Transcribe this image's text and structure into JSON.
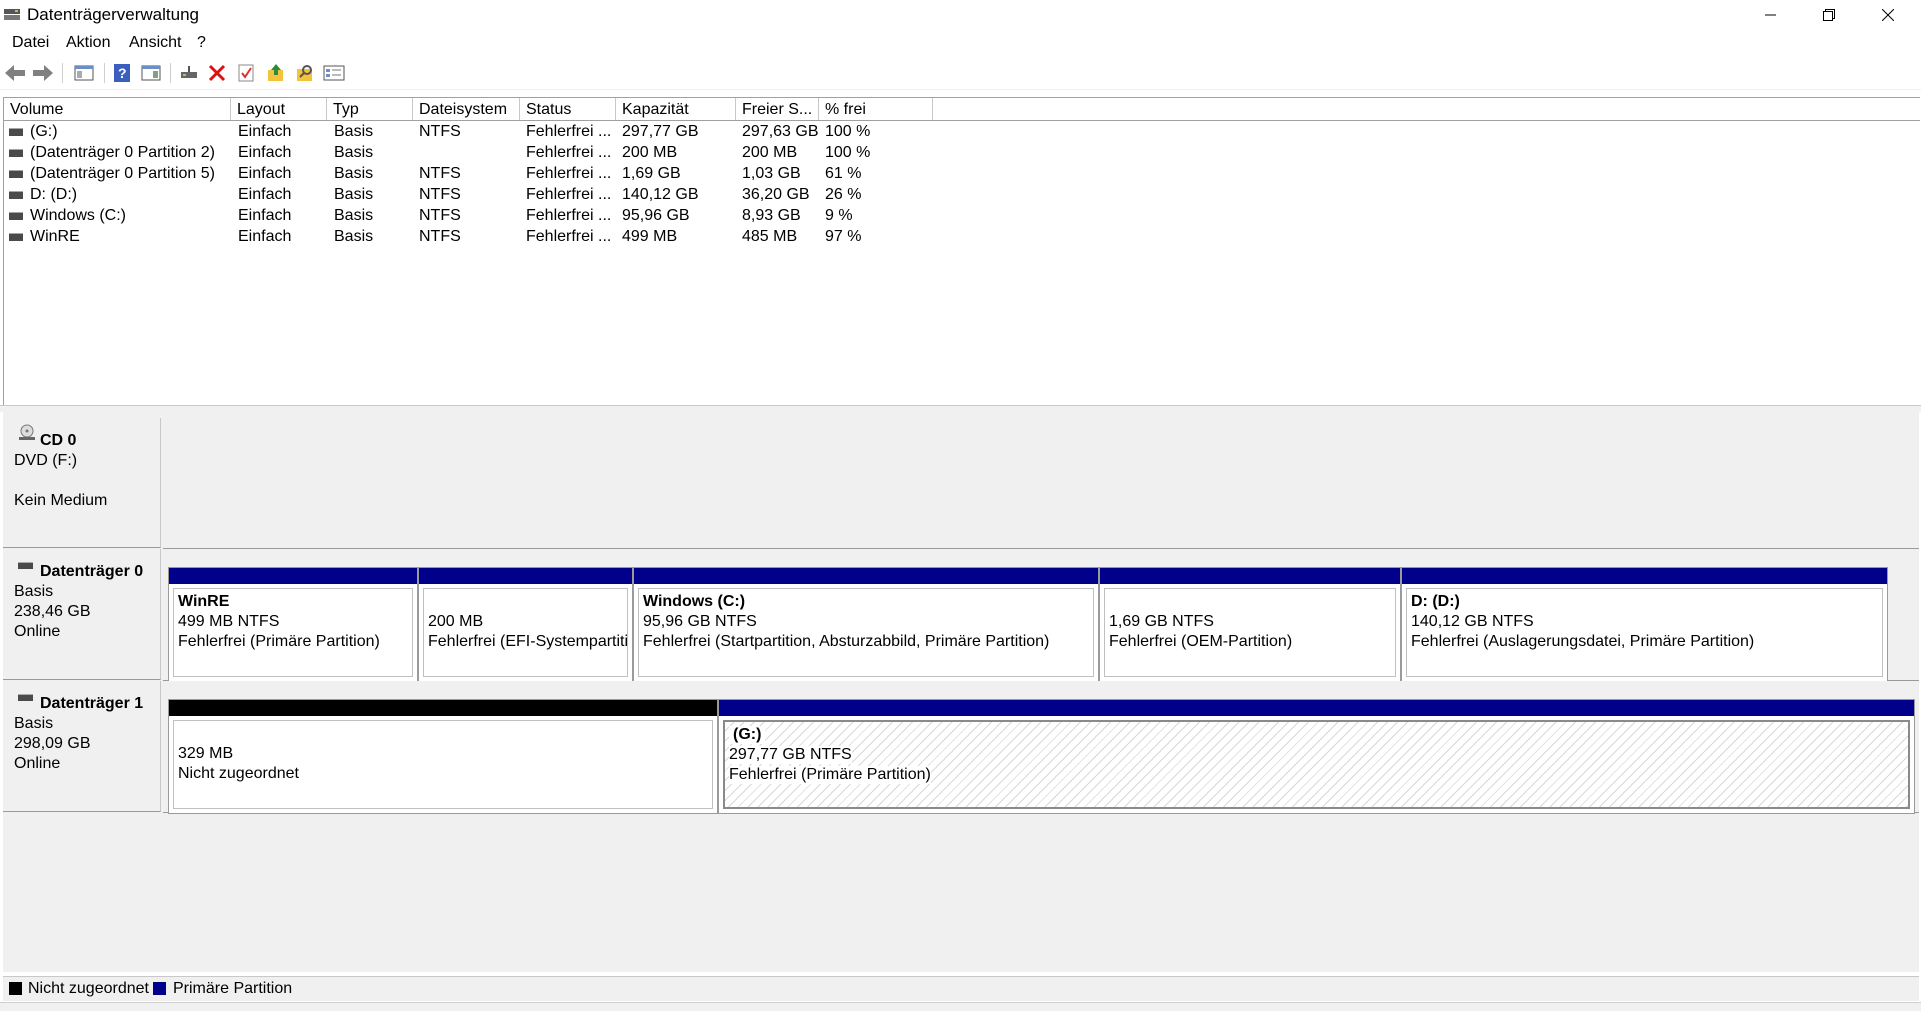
{
  "window": {
    "title": "Datenträgerverwaltung"
  },
  "menu": [
    "Datei",
    "Aktion",
    "Ansicht",
    "?"
  ],
  "toolbar_icons": [
    "back-arrow-icon",
    "forward-arrow-icon",
    "console-tree-icon",
    "help-icon",
    "properties-view-icon",
    "connect-drive-icon",
    "delete-icon",
    "check-icon",
    "export-list-icon",
    "search-folder-icon",
    "list-view-icon"
  ],
  "table": {
    "headers": [
      "Volume",
      "Layout",
      "Typ",
      "Dateisystem",
      "Status",
      "Kapazität",
      "Freier S...",
      "% frei"
    ],
    "rows": [
      [
        "(G:)",
        "Einfach",
        "Basis",
        "NTFS",
        "Fehlerfrei ...",
        "297,77 GB",
        "297,63 GB",
        "100 %"
      ],
      [
        "(Datenträger 0 Partition 2)",
        "Einfach",
        "Basis",
        "",
        "Fehlerfrei ...",
        "200 MB",
        "200 MB",
        "100 %"
      ],
      [
        "(Datenträger 0 Partition 5)",
        "Einfach",
        "Basis",
        "NTFS",
        "Fehlerfrei ...",
        "1,69 GB",
        "1,03 GB",
        "61 %"
      ],
      [
        "D: (D:)",
        "Einfach",
        "Basis",
        "NTFS",
        "Fehlerfrei ...",
        "140,12 GB",
        "36,20 GB",
        "26 %"
      ],
      [
        "Windows (C:)",
        "Einfach",
        "Basis",
        "NTFS",
        "Fehlerfrei ...",
        "95,96 GB",
        "8,93 GB",
        "9 %"
      ],
      [
        "WinRE",
        "Einfach",
        "Basis",
        "NTFS",
        "Fehlerfrei ...",
        "499 MB",
        "485 MB",
        "97 %"
      ]
    ]
  },
  "cd0": {
    "title": "CD 0",
    "lines": [
      "DVD (F:)",
      "",
      "Kein Medium"
    ]
  },
  "disk0": {
    "title": "Datenträger 0",
    "lines": [
      "Basis",
      "238,46 GB",
      "Online"
    ],
    "partitions": [
      {
        "name": "WinRE",
        "size": "499 MB NTFS",
        "status": "Fehlerfrei (Primäre Partition)"
      },
      {
        "name": "",
        "size": "200 MB",
        "status": "Fehlerfrei (EFI-Systempartition)"
      },
      {
        "name": "Windows  (C:)",
        "size": "95,96 GB NTFS",
        "status": "Fehlerfrei (Startpartition, Absturzabbild, Primäre Partition)"
      },
      {
        "name": "",
        "size": "1,69 GB NTFS",
        "status": "Fehlerfrei (OEM-Partition)"
      },
      {
        "name": "D:  (D:)",
        "size": "140,12 GB NTFS",
        "status": "Fehlerfrei (Auslagerungsdatei, Primäre Partition)"
      }
    ]
  },
  "disk1": {
    "title": "Datenträger 1",
    "lines": [
      "Basis",
      "298,09 GB",
      "Online"
    ],
    "partitions": [
      {
        "name": "",
        "size": "329 MB",
        "status": "Nicht zugeordnet"
      },
      {
        "name": "(G:)",
        "size": "297,77 GB NTFS",
        "status": "Fehlerfrei (Primäre Partition)"
      }
    ]
  },
  "legend": [
    {
      "label": "Nicht zugeordnet",
      "color": "#000000"
    },
    {
      "label": "Primäre Partition",
      "color": "#00008b"
    }
  ]
}
